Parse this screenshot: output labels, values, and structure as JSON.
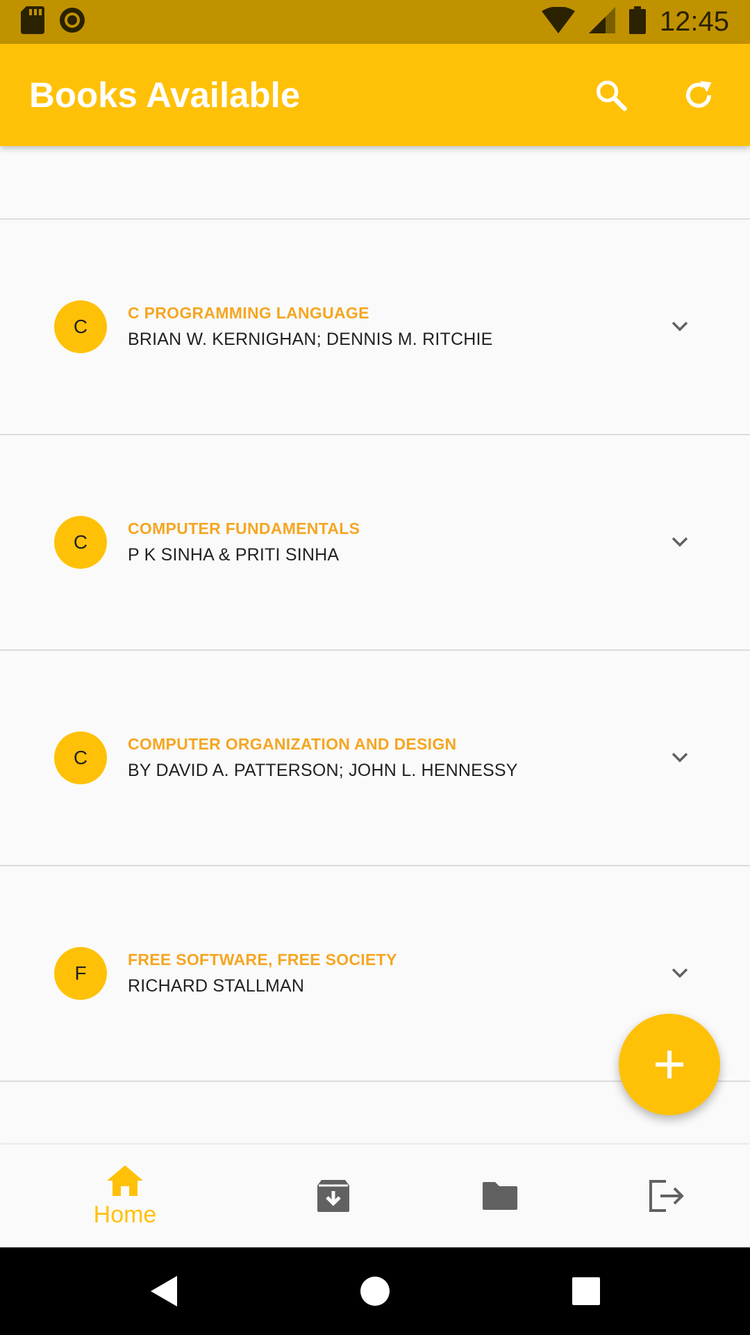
{
  "status_bar": {
    "time": "12:45",
    "icons": [
      "sd-card-icon",
      "circle-record-icon",
      "wifi-icon",
      "signal-icon",
      "battery-icon"
    ]
  },
  "app_bar": {
    "title": "Books Available",
    "actions": [
      "search-icon",
      "refresh-icon"
    ]
  },
  "books": [
    {
      "initial": "C",
      "title": "C PROGRAMMING LANGUAGE",
      "author": "BRIAN W. KERNIGHAN; DENNIS M. RITCHIE"
    },
    {
      "initial": "C",
      "title": "COMPUTER FUNDAMENTALS",
      "author": "P K SINHA & PRITI SINHA"
    },
    {
      "initial": "C",
      "title": "COMPUTER ORGANIZATION AND DESIGN",
      "author": "BY DAVID A. PATTERSON; JOHN L. HENNESSY"
    },
    {
      "initial": "F",
      "title": "FREE SOFTWARE, FREE SOCIETY",
      "author": "RICHARD STALLMAN"
    }
  ],
  "fab": {
    "icon": "plus-icon"
  },
  "bottom_nav": {
    "items": [
      {
        "icon": "home-icon",
        "label": "Home",
        "active": true
      },
      {
        "icon": "archive-download-icon",
        "label": ""
      },
      {
        "icon": "folder-icon",
        "label": ""
      },
      {
        "icon": "logout-icon",
        "label": ""
      }
    ]
  },
  "system_nav": [
    "back-icon",
    "home-circle-icon",
    "recents-icon"
  ],
  "colors": {
    "primary": "#ffc107",
    "status_bar": "#c09200",
    "title_accent": "#f5a623",
    "icon_gray": "#616161"
  }
}
